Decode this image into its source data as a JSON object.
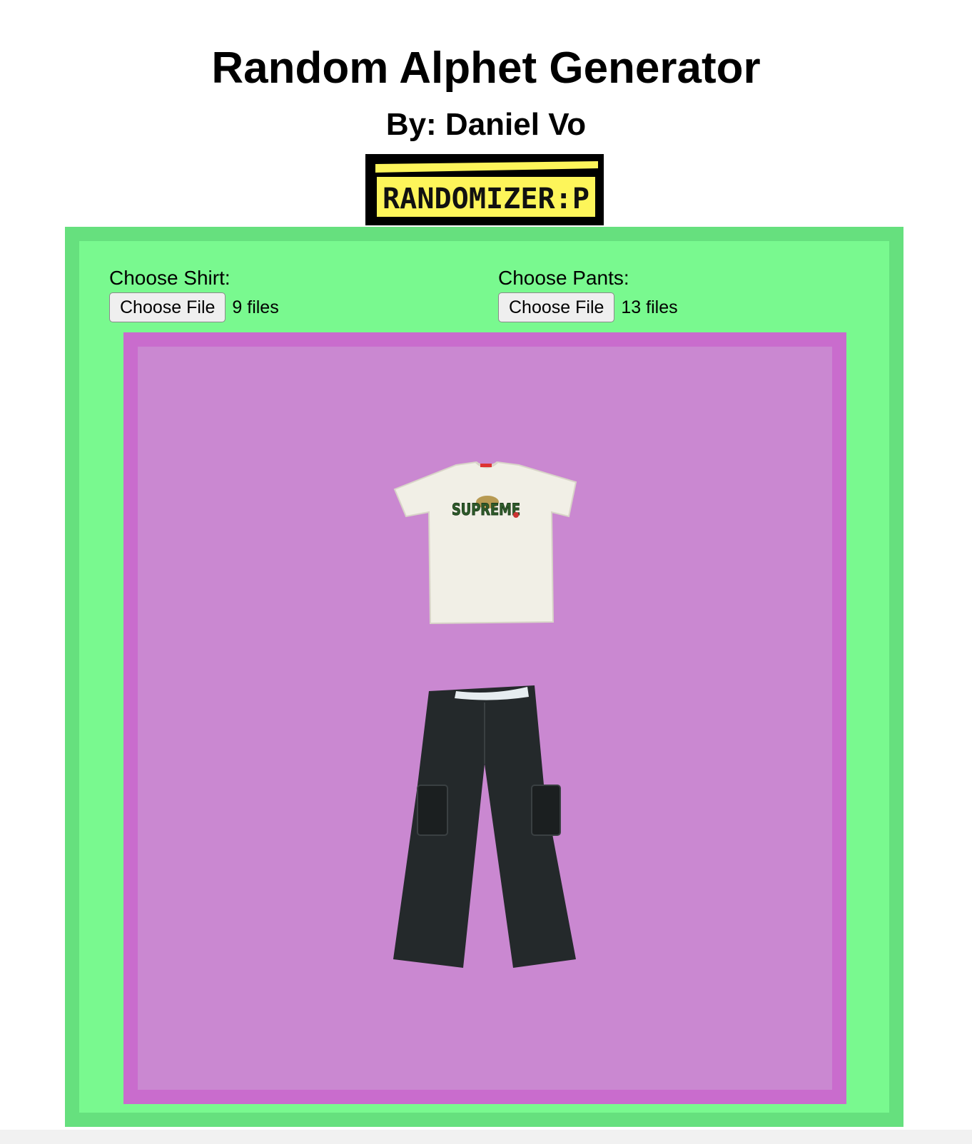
{
  "header": {
    "title": "Random Alphet Generator",
    "byline": "By: Daniel Vo",
    "logo_text": "RANDOMIZER:P"
  },
  "pickers": {
    "shirt": {
      "label": "Choose Shirt:",
      "button_label": "Choose File",
      "file_status": "9 files"
    },
    "pants": {
      "label": "Choose Pants:",
      "button_label": "Choose File",
      "file_status": "13 files"
    }
  },
  "outfit": {
    "shirt_print": "SUPREME"
  },
  "colors": {
    "outer_border": "#66e07e",
    "outer_fill": "#79f98f",
    "stage_border": "#c96ccd",
    "stage_fill": "#ca88d1",
    "logo_yellow": "#fdf55a"
  }
}
